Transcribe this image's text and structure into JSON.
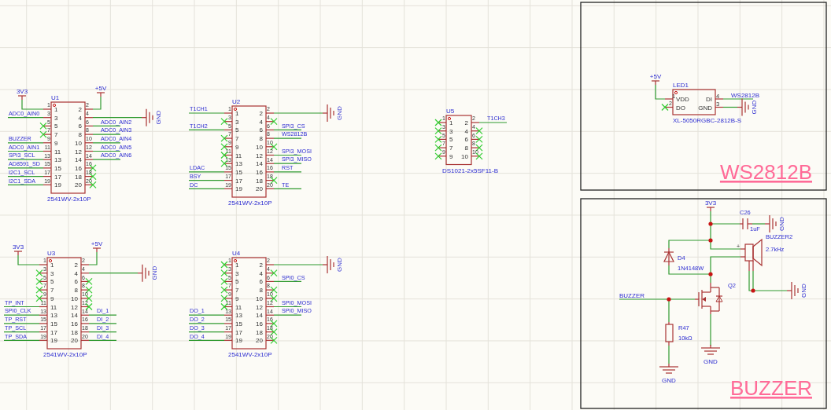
{
  "headers": [
    {
      "designator": "U1",
      "footprint": "2541WV-2x10P",
      "pins": [
        {
          "number": "1",
          "name": "1",
          "kind": "supply",
          "net": "3V3"
        },
        {
          "number": "2",
          "name": "2",
          "kind": "supply",
          "net": "+5V"
        },
        {
          "number": "3",
          "name": "3",
          "kind": "net",
          "net": "ADC0_AIN0"
        },
        {
          "number": "4",
          "name": "4",
          "kind": "ground",
          "net": "GND"
        },
        {
          "number": "5",
          "name": "5",
          "kind": "nc"
        },
        {
          "number": "6",
          "name": "6",
          "kind": "net",
          "net": "ADC0_AIN2"
        },
        {
          "number": "7",
          "name": "7",
          "kind": "nc"
        },
        {
          "number": "8",
          "name": "8",
          "kind": "net",
          "net": "ADC0_AIN3"
        },
        {
          "number": "9",
          "name": "9",
          "kind": "net",
          "net": "BUZZER"
        },
        {
          "number": "10",
          "name": "10",
          "kind": "net",
          "net": "ADC0_AIN4"
        },
        {
          "number": "11",
          "name": "11",
          "kind": "net",
          "net": "ADC0_AIN1"
        },
        {
          "number": "12",
          "name": "12",
          "kind": "net",
          "net": "ADC0_AIN5"
        },
        {
          "number": "13",
          "name": "13",
          "kind": "net",
          "net": "SPI3_SCL"
        },
        {
          "number": "14",
          "name": "14",
          "kind": "net",
          "net": "ADC0_AIN6"
        },
        {
          "number": "15",
          "name": "15",
          "kind": "net",
          "net": "AD8591_SD"
        },
        {
          "number": "16",
          "name": "16",
          "kind": "nc"
        },
        {
          "number": "17",
          "name": "17",
          "kind": "net",
          "net": "I2C1_SCL"
        },
        {
          "number": "18",
          "name": "18",
          "kind": "nc"
        },
        {
          "number": "19",
          "name": "19",
          "kind": "net",
          "net": "I2C1_SDA"
        },
        {
          "number": "20",
          "name": "20",
          "kind": "nc"
        }
      ]
    },
    {
      "designator": "U2",
      "footprint": "2541WV-2x10P",
      "pins": [
        {
          "number": "1",
          "name": "1",
          "kind": "net",
          "net": "T1CH1"
        },
        {
          "number": "2",
          "name": "2",
          "kind": "ground",
          "net": "GND"
        },
        {
          "number": "3",
          "name": "3",
          "kind": "nc"
        },
        {
          "number": "4",
          "name": "4",
          "kind": "nc"
        },
        {
          "number": "5",
          "name": "5",
          "kind": "net",
          "net": "T1CH2"
        },
        {
          "number": "6",
          "name": "6",
          "kind": "net",
          "net": "SPI3_CS"
        },
        {
          "number": "7",
          "name": "7",
          "kind": "nc"
        },
        {
          "number": "8",
          "name": "8",
          "kind": "net",
          "net": "WS2812B"
        },
        {
          "number": "9",
          "name": "9",
          "kind": "nc"
        },
        {
          "number": "10",
          "name": "10",
          "kind": "nc"
        },
        {
          "number": "11",
          "name": "11",
          "kind": "nc"
        },
        {
          "number": "12",
          "name": "12",
          "kind": "net",
          "net": "SPI3_MOSI"
        },
        {
          "number": "13",
          "name": "13",
          "kind": "nc"
        },
        {
          "number": "14",
          "name": "14",
          "kind": "net",
          "net": "SPI3_MISO"
        },
        {
          "number": "15",
          "name": "15",
          "kind": "net",
          "net": "LDAC"
        },
        {
          "number": "16",
          "name": "16",
          "kind": "net",
          "net": "RST"
        },
        {
          "number": "17",
          "name": "17",
          "kind": "net",
          "net": "BSY"
        },
        {
          "number": "18",
          "name": "18",
          "kind": "nc"
        },
        {
          "number": "19",
          "name": "19",
          "kind": "net",
          "net": "DC"
        },
        {
          "number": "20",
          "name": "20",
          "kind": "net",
          "net": "TE"
        }
      ]
    },
    {
      "designator": "U3",
      "footprint": "2541WV-2x10P",
      "pins": [
        {
          "number": "1",
          "name": "1",
          "kind": "supply",
          "net": "3V3"
        },
        {
          "number": "2",
          "name": "2",
          "kind": "supply",
          "net": "+5V"
        },
        {
          "number": "3",
          "name": "3",
          "kind": "nc"
        },
        {
          "number": "4",
          "name": "4",
          "kind": "ground",
          "net": "GND"
        },
        {
          "number": "5",
          "name": "5",
          "kind": "nc"
        },
        {
          "number": "6",
          "name": "6",
          "kind": "nc"
        },
        {
          "number": "7",
          "name": "7",
          "kind": "nc"
        },
        {
          "number": "8",
          "name": "8",
          "kind": "nc"
        },
        {
          "number": "9",
          "name": "9",
          "kind": "nc"
        },
        {
          "number": "10",
          "name": "10",
          "kind": "nc"
        },
        {
          "number": "11",
          "name": "11",
          "kind": "net",
          "net": "TP_INT"
        },
        {
          "number": "12",
          "name": "12",
          "kind": "nc"
        },
        {
          "number": "13",
          "name": "13",
          "kind": "net",
          "net": "SPI0_CLK"
        },
        {
          "number": "14",
          "name": "14",
          "kind": "net",
          "net": "DI_1"
        },
        {
          "number": "15",
          "name": "15",
          "kind": "net",
          "net": "TP_RST"
        },
        {
          "number": "16",
          "name": "16",
          "kind": "net",
          "net": "DI_2"
        },
        {
          "number": "17",
          "name": "17",
          "kind": "net",
          "net": "TP_SCL"
        },
        {
          "number": "18",
          "name": "18",
          "kind": "net",
          "net": "DI_3"
        },
        {
          "number": "19",
          "name": "19",
          "kind": "net",
          "net": "TP_SDA"
        },
        {
          "number": "20",
          "name": "20",
          "kind": "net",
          "net": "DI_4"
        }
      ]
    },
    {
      "designator": "U4",
      "footprint": "2541WV-2x10P",
      "pins": [
        {
          "number": "1",
          "name": "1",
          "kind": "nc"
        },
        {
          "number": "2",
          "name": "2",
          "kind": "ground",
          "net": "GND"
        },
        {
          "number": "3",
          "name": "3",
          "kind": "nc"
        },
        {
          "number": "4",
          "name": "4",
          "kind": "nc"
        },
        {
          "number": "5",
          "name": "5",
          "kind": "nc"
        },
        {
          "number": "6",
          "name": "6",
          "kind": "net",
          "net": "SPI0_CS"
        },
        {
          "number": "7",
          "name": "7",
          "kind": "nc"
        },
        {
          "number": "8",
          "name": "8",
          "kind": "nc"
        },
        {
          "number": "9",
          "name": "9",
          "kind": "nc"
        },
        {
          "number": "10",
          "name": "10",
          "kind": "nc"
        },
        {
          "number": "11",
          "name": "11",
          "kind": "nc"
        },
        {
          "number": "12",
          "name": "12",
          "kind": "net",
          "net": "SPI0_MOSI"
        },
        {
          "number": "13",
          "name": "13",
          "kind": "net",
          "net": "DO_1"
        },
        {
          "number": "14",
          "name": "14",
          "kind": "net",
          "net": "SPI0_MISO"
        },
        {
          "number": "15",
          "name": "15",
          "kind": "net",
          "net": "DO_2"
        },
        {
          "number": "16",
          "name": "16",
          "kind": "nc"
        },
        {
          "number": "17",
          "name": "17",
          "kind": "net",
          "net": "DO_3"
        },
        {
          "number": "18",
          "name": "18",
          "kind": "nc"
        },
        {
          "number": "19",
          "name": "19",
          "kind": "net",
          "net": "DO_4"
        },
        {
          "number": "20",
          "name": "20",
          "kind": "nc"
        }
      ]
    },
    {
      "designator": "U5",
      "footprint": "DS1021-2x5SF11-B",
      "pins": [
        {
          "number": "1",
          "name": "1",
          "kind": "nc"
        },
        {
          "number": "2",
          "name": "2",
          "kind": "net",
          "net": "T1CH3"
        },
        {
          "number": "3",
          "name": "3",
          "kind": "nc"
        },
        {
          "number": "4",
          "name": "4",
          "kind": "nc"
        },
        {
          "number": "5",
          "name": "5",
          "kind": "nc"
        },
        {
          "number": "6",
          "name": "6",
          "kind": "nc"
        },
        {
          "number": "7",
          "name": "7",
          "kind": "nc"
        },
        {
          "number": "8",
          "name": "8",
          "kind": "nc"
        },
        {
          "number": "9",
          "name": "9",
          "kind": "nc"
        },
        {
          "number": "10",
          "name": "10",
          "kind": "nc"
        }
      ]
    }
  ],
  "led": {
    "designator": "LED1",
    "part": "XL-5050RGBC-2812B-S",
    "pins": [
      {
        "number": "1",
        "name": "VDD",
        "kind": "supply",
        "net": "+5V"
      },
      {
        "number": "2",
        "name": "DO",
        "kind": "nc"
      },
      {
        "number": "4",
        "name": "DI",
        "kind": "net",
        "net": "WS2812B"
      },
      {
        "number": "3",
        "name": "GND",
        "kind": "ground",
        "net": "GND"
      }
    ]
  },
  "buzzer": {
    "supply": "3V3",
    "capacitor": {
      "designator": "C26",
      "value": "1uF"
    },
    "speaker": {
      "designator": "BUZZER2",
      "value": "2.7kHz",
      "polarity": "+"
    },
    "diode": {
      "designator": "D4",
      "value": "1N4148W"
    },
    "transistor": {
      "designator": "Q2"
    },
    "resistor": {
      "designator": "R47",
      "value": "10kΩ"
    },
    "input_net": "BUZZER",
    "grounds": [
      "GND",
      "GND",
      "GND",
      "GND"
    ]
  },
  "sheets": [
    {
      "title": "WS2812B"
    },
    {
      "title": "BUZZER"
    }
  ]
}
